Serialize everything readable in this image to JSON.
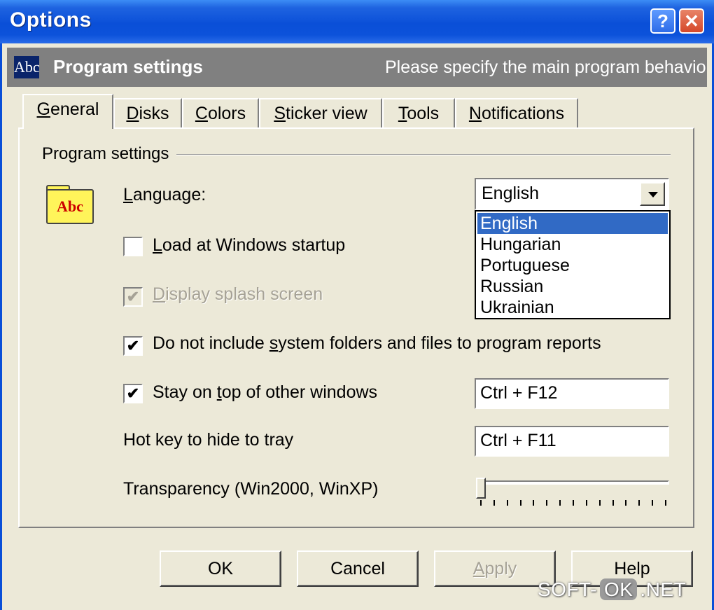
{
  "window": {
    "title": "Options",
    "help_glyph": "?",
    "close_glyph": "✕"
  },
  "header": {
    "icon_text": "Abc",
    "title": "Program settings",
    "subtitle": "Please specify the main program behavior"
  },
  "tabs": [
    {
      "pre": "",
      "key": "G",
      "post": "eneral",
      "active": true
    },
    {
      "pre": "",
      "key": "D",
      "post": "isks"
    },
    {
      "pre": "",
      "key": "C",
      "post": "olors"
    },
    {
      "pre": "",
      "key": "S",
      "post": "ticker view"
    },
    {
      "pre": "",
      "key": "T",
      "post": "ools"
    },
    {
      "pre": "",
      "key": "N",
      "post": "otifications"
    }
  ],
  "group": {
    "label": "Program settings",
    "icon_text": "Abc"
  },
  "language": {
    "label_pre": "",
    "label_key": "L",
    "label_post": "anguage:",
    "selected": "English",
    "options": [
      "English",
      "Hungarian",
      "Portuguese",
      "Russian",
      "Ukrainian"
    ]
  },
  "options": {
    "load_startup": {
      "pre": "",
      "key": "L",
      "post": "oad at Windows startup",
      "checked": false
    },
    "splash": {
      "pre": "",
      "key": "D",
      "post": "isplay splash screen",
      "checked": true,
      "disabled": true
    },
    "system_folders": {
      "pre": "Do not include ",
      "key": "s",
      "post": "ystem folders and files to program reports",
      "checked": true
    },
    "stay_on_top": {
      "pre": "Stay on ",
      "key": "t",
      "post": "op of other windows",
      "checked": true,
      "hotkey": "Ctrl + F12"
    }
  },
  "hide_tray": {
    "label": "Hot key to hide to tray",
    "hotkey": "Ctrl + F11"
  },
  "transparency": {
    "label": "Transparency (Win2000, WinXP)",
    "value": 0,
    "ticks": 15
  },
  "buttons": {
    "ok": "OK",
    "cancel": "Cancel",
    "apply_key": "A",
    "apply_rest": "pply",
    "help": "Help"
  },
  "watermark": {
    "left": "SOFT-",
    "middle": "OK",
    "right": ".NET"
  },
  "colors": {
    "titlebar": "#0A4FD8",
    "face": "#ECE9D8",
    "header": "#808080",
    "selection": "#316AC5"
  }
}
